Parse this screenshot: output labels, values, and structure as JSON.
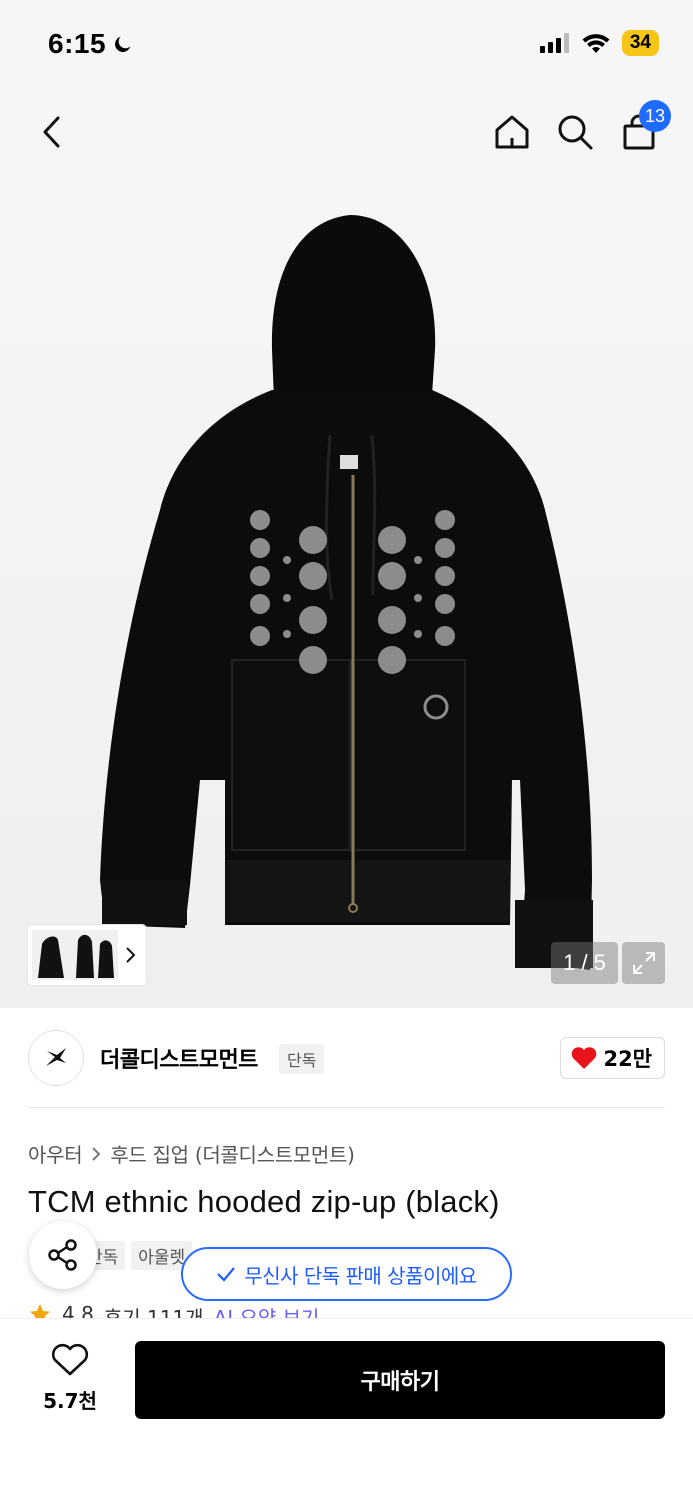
{
  "status_bar": {
    "time": "6:15",
    "battery": "34"
  },
  "nav": {
    "cart_count": "13"
  },
  "gallery": {
    "counter": "1 / 5"
  },
  "brand": {
    "name": "더콜디스트모먼트",
    "exclusive_tag": "단독",
    "likes": "22만"
  },
  "breadcrumb": {
    "category": "아우터",
    "subcategory": "후드 집업 (더콜디스트모먼트)"
  },
  "product": {
    "title": "TCM ethnic hooded zip-up (black)",
    "tags": [
      "단독",
      "아울렛"
    ],
    "rating": "4.8",
    "reviews": "후기 111개",
    "ai_summary": "AI 요약 보기"
  },
  "toast": {
    "message": "무신사 단독 판매 상품이에요"
  },
  "bottom": {
    "wish_count": "5.7천",
    "buy_label": "구매하기"
  },
  "colors": {
    "accent_blue": "#1e6bff",
    "like_red": "#e8141b",
    "star": "#f2a60c"
  }
}
